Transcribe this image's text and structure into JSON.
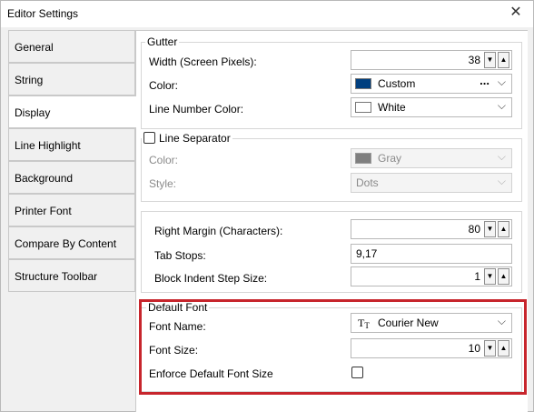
{
  "window": {
    "title": "Editor Settings"
  },
  "sidebar": {
    "items": [
      {
        "label": "General"
      },
      {
        "label": "String"
      },
      {
        "label": "Display"
      },
      {
        "label": "Line Highlight"
      },
      {
        "label": "Background"
      },
      {
        "label": "Printer Font"
      },
      {
        "label": "Compare By Content"
      },
      {
        "label": "Structure Toolbar"
      }
    ],
    "active": "Display"
  },
  "gutter": {
    "legend": "Gutter",
    "width_label": "Width (Screen Pixels):",
    "width_value": "38",
    "color_label": "Color:",
    "color_value": "Custom",
    "color_swatch": "#003f7f",
    "line_number_color_label": "Line Number Color:",
    "line_number_color_value": "White"
  },
  "line_separator": {
    "legend": "Line Separator",
    "checked": false,
    "color_label": "Color:",
    "color_value": "Gray",
    "color_swatch": "#7f7f7f",
    "style_label": "Style:",
    "style_value": "Dots"
  },
  "margins": {
    "right_margin_label": "Right Margin (Characters):",
    "right_margin_value": "80",
    "tab_stops_label": "Tab Stops:",
    "tab_stops_value": "9,17",
    "block_indent_label": "Block Indent Step Size:",
    "block_indent_value": "1"
  },
  "default_font": {
    "legend": "Default Font",
    "font_name_label": "Font Name:",
    "font_name_value": "Courier New",
    "font_size_label": "Font Size:",
    "font_size_value": "10",
    "enforce_label": "Enforce Default Font Size",
    "enforce_checked": false,
    "highlight_color": "#c7252c"
  }
}
